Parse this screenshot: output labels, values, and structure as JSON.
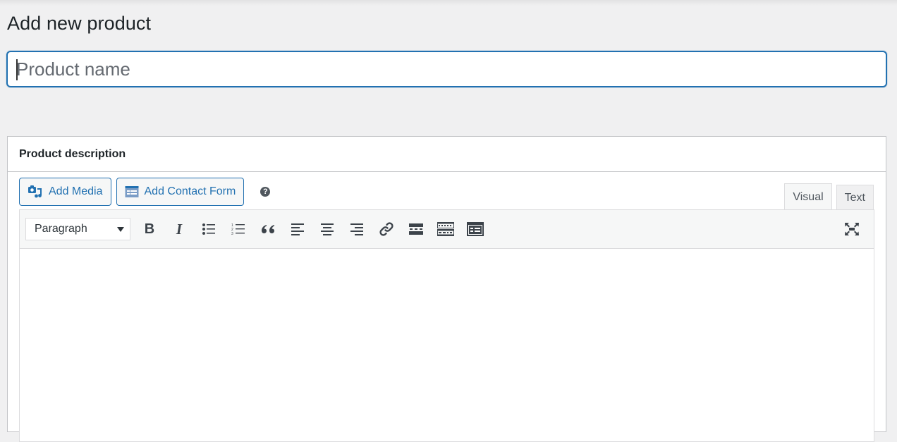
{
  "page": {
    "title": "Add new product"
  },
  "title_field": {
    "value": "",
    "placeholder": "Product name"
  },
  "description_box": {
    "title": "Product description",
    "buttons": {
      "add_media": "Add Media",
      "add_contact_form": "Add Contact Form"
    },
    "help_icon": "?",
    "tabs": [
      {
        "label": "Visual",
        "active": true
      },
      {
        "label": "Text",
        "active": false
      }
    ],
    "toolbar": {
      "format_select": "Paragraph",
      "buttons": [
        {
          "icon": "bold-icon",
          "glyph": "B"
        },
        {
          "icon": "italic-icon",
          "glyph": "I"
        },
        {
          "icon": "bulleted-list-icon"
        },
        {
          "icon": "numbered-list-icon"
        },
        {
          "icon": "blockquote-icon",
          "glyph": "“"
        },
        {
          "icon": "align-left-icon"
        },
        {
          "icon": "align-center-icon"
        },
        {
          "icon": "align-right-icon"
        },
        {
          "icon": "link-icon"
        },
        {
          "icon": "read-more-icon"
        },
        {
          "icon": "toolbar-toggle-icon"
        },
        {
          "icon": "form-icon"
        }
      ],
      "fullscreen_icon": "fullscreen-icon"
    },
    "content": ""
  },
  "colors": {
    "accent": "#2271b1",
    "background": "#f0f0f1",
    "icon": "#3c434a"
  }
}
